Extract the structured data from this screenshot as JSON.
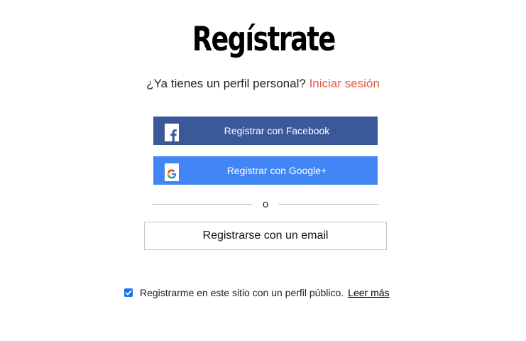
{
  "page": {
    "title": "Regístrate",
    "subtitle_prefix": "¿Ya tienes un perfil personal?",
    "login_link": "Iniciar sesión"
  },
  "social": {
    "facebook_label": "Registrar con Facebook",
    "google_label": "Registrar con Google+",
    "facebook_color": "#3b5998",
    "google_color": "#4285f4"
  },
  "divider": {
    "text": "o"
  },
  "email_button": {
    "label": "Registrarse con un email"
  },
  "consent": {
    "checked": true,
    "text": "Registrarme en este sitio con un perfil público.",
    "read_more": "Leer más"
  },
  "colors": {
    "link_accent": "#e8553e",
    "checkbox": "#1a73e8"
  }
}
